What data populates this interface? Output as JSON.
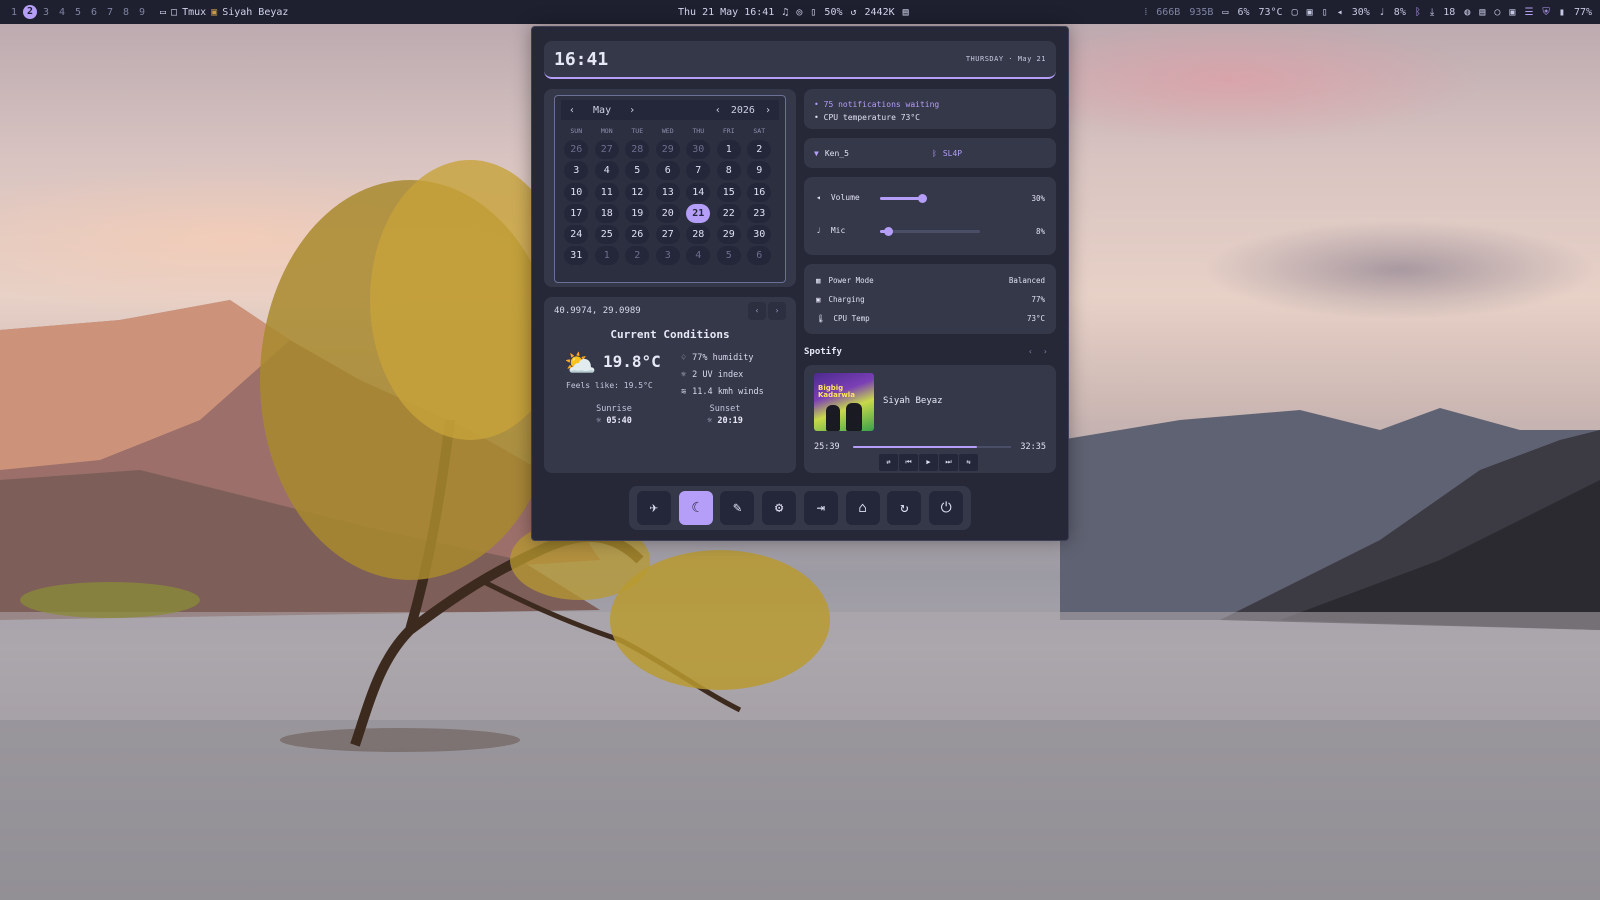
{
  "topbar": {
    "workspaces": [
      "1",
      "2",
      "3",
      "4",
      "5",
      "6",
      "7",
      "8",
      "9"
    ],
    "active_workspace": "2",
    "app1": "Tmux",
    "app2": "Siyah Beyaz",
    "datetime": "Thu 21 May 16:41",
    "battery_center": "50%",
    "network_center": "2442K",
    "mem1": "666B",
    "mem2": "935B",
    "cpu": "6%",
    "temp": "73°C",
    "volume": "30%",
    "mic": "8%",
    "updates": "18",
    "battery": "77%"
  },
  "clock": {
    "time": "16:41",
    "date": "THURSDAY · May 21"
  },
  "calendar": {
    "month": "May",
    "year": "2026",
    "dows": [
      "SUN",
      "MON",
      "TUE",
      "WED",
      "THU",
      "FRI",
      "SAT"
    ],
    "weeks": [
      [
        "26",
        "27",
        "28",
        "29",
        "30",
        "1",
        "2"
      ],
      [
        "3",
        "4",
        "5",
        "6",
        "7",
        "8",
        "9"
      ],
      [
        "10",
        "11",
        "12",
        "13",
        "14",
        "15",
        "16"
      ],
      [
        "17",
        "18",
        "19",
        "20",
        "21",
        "22",
        "23"
      ],
      [
        "24",
        "25",
        "26",
        "27",
        "28",
        "29",
        "30"
      ],
      [
        "31",
        "1",
        "2",
        "3",
        "4",
        "5",
        "6"
      ]
    ],
    "today": "21"
  },
  "weather": {
    "coords": "40.9974, 29.0989",
    "title": "Current Conditions",
    "temp": "19.8°C",
    "feels": "Feels like: 19.5°C",
    "humidity": "77% humidity",
    "uv": "2 UV index",
    "wind": "11.4 kmh winds",
    "sunrise_label": "Sunrise",
    "sunrise": "05:40",
    "sunset_label": "Sunset",
    "sunset": "20:19"
  },
  "notifications": {
    "line1": "• 75 notifications waiting",
    "line2": "• CPU temperature 73°C"
  },
  "network": {
    "wifi": "Ken_5",
    "bluetooth": "SL4P"
  },
  "sliders": {
    "volume_label": "Volume",
    "volume_value": "30%",
    "volume_level": 0.3,
    "mic_label": "Mic",
    "mic_value": "8%",
    "mic_level": 0.08
  },
  "power": {
    "mode_label": "Power Mode",
    "mode_value": "Balanced",
    "charging_label": "Charging",
    "charging_value": "77%",
    "cputemp_label": "CPU Temp",
    "cputemp_value": "73°C"
  },
  "spotify": {
    "header": "Spotify",
    "song": "Siyah Beyaz",
    "art_text": "Bigbig Kadarwla",
    "current": "25:39",
    "total": "32:35",
    "progress": 0.787
  },
  "colors": {
    "accent": "#b59ef7",
    "panel": "#262838",
    "card": "#353849"
  },
  "dock_icons": [
    "airplane-icon",
    "night-light-icon",
    "color-picker-icon",
    "gear-icon",
    "logout-icon",
    "lock-icon",
    "restart-icon",
    "power-icon"
  ]
}
